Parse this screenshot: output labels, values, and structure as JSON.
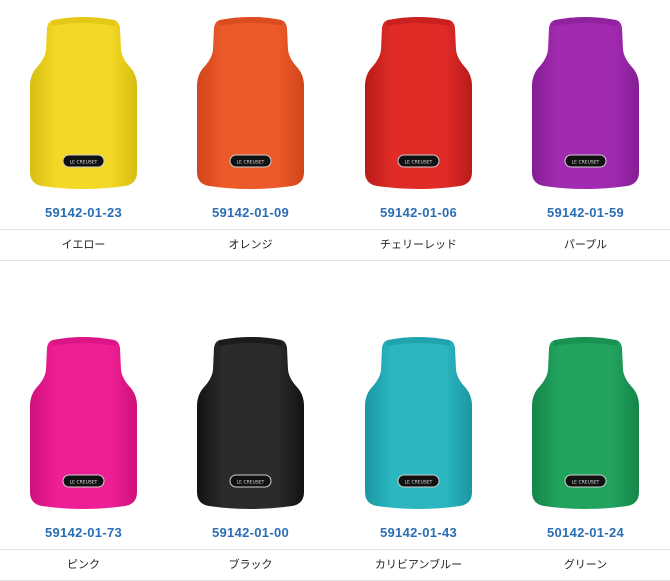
{
  "products": [
    {
      "code": "59142-01-23",
      "name": "イエロー",
      "color": "#f3d925",
      "shade": "#d8bd10",
      "logo_text": "LE CREUSET"
    },
    {
      "code": "59142-01-09",
      "name": "オレンジ",
      "color": "#ec5a2a",
      "shade": "#d0451a",
      "logo_text": "LE CREUSET"
    },
    {
      "code": "59142-01-06",
      "name": "チェリーレッド",
      "color": "#e02b26",
      "shade": "#b81b1a",
      "logo_text": "LE CREUSET"
    },
    {
      "code": "59142-01-59",
      "name": "パープル",
      "color": "#a12bb0",
      "shade": "#861d95",
      "logo_text": "LE CREUSET"
    },
    {
      "code": "59142-01-73",
      "name": "ピンク",
      "color": "#ee1f94",
      "shade": "#cf0f7c",
      "logo_text": "LE CREUSET"
    },
    {
      "code": "59142-01-00",
      "name": "ブラック",
      "color": "#2b2b2b",
      "shade": "#121212",
      "logo_text": "LE CREUSET"
    },
    {
      "code": "59142-01-43",
      "name": "カリビアンブルー",
      "color": "#2bb6c0",
      "shade": "#1a97a1",
      "logo_text": "LE CREUSET"
    },
    {
      "code": "50142-01-24",
      "name": "グリーン",
      "color": "#21a35e",
      "shade": "#148548",
      "logo_text": "LE CREUSET"
    }
  ]
}
